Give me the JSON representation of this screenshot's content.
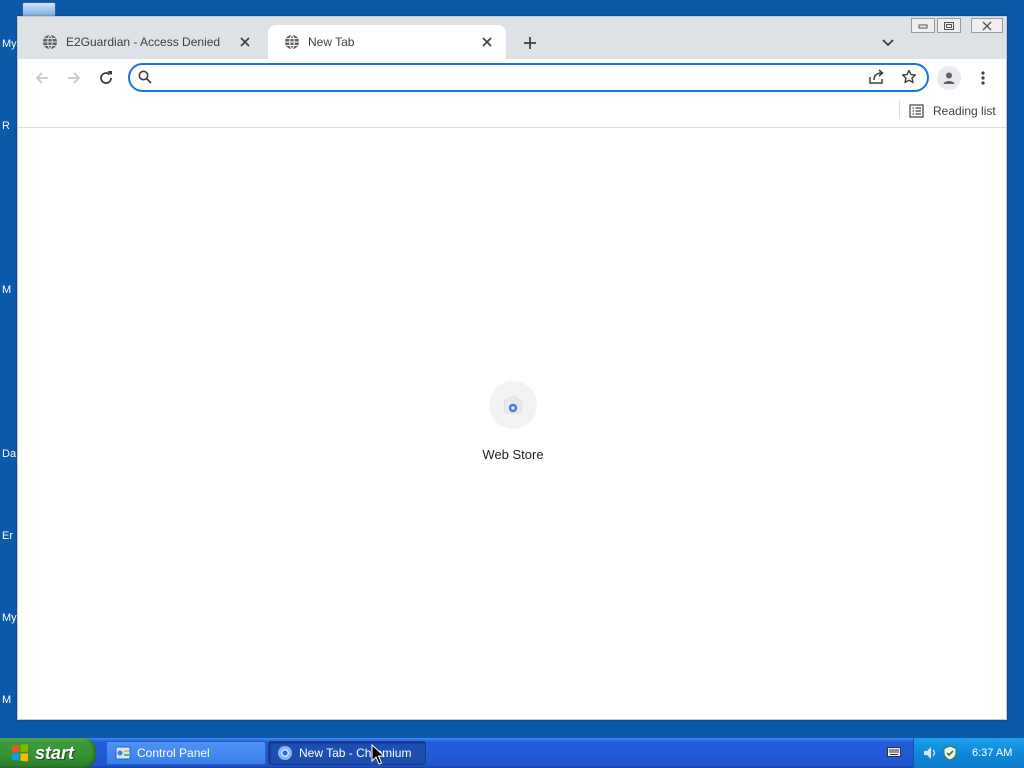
{
  "desktop": {
    "labels": [
      "My",
      "R",
      "M",
      "Da",
      "Er",
      "My",
      "M"
    ]
  },
  "browser": {
    "tabs": [
      {
        "title": "E2Guardian - Access Denied",
        "active": false
      },
      {
        "title": "New Tab",
        "active": true
      }
    ],
    "omnibox": {
      "value": "",
      "placeholder": ""
    },
    "bookmarks": {
      "reading_list_label": "Reading list"
    },
    "new_tab_page": {
      "shortcuts": [
        {
          "label": "Web Store"
        }
      ]
    },
    "accent_color": "#1a73e8"
  },
  "taskbar": {
    "start_label": "start",
    "items": [
      {
        "label": "Control Panel"
      },
      {
        "label": "New Tab - Chromium"
      }
    ],
    "clock": "6:37 AM"
  }
}
